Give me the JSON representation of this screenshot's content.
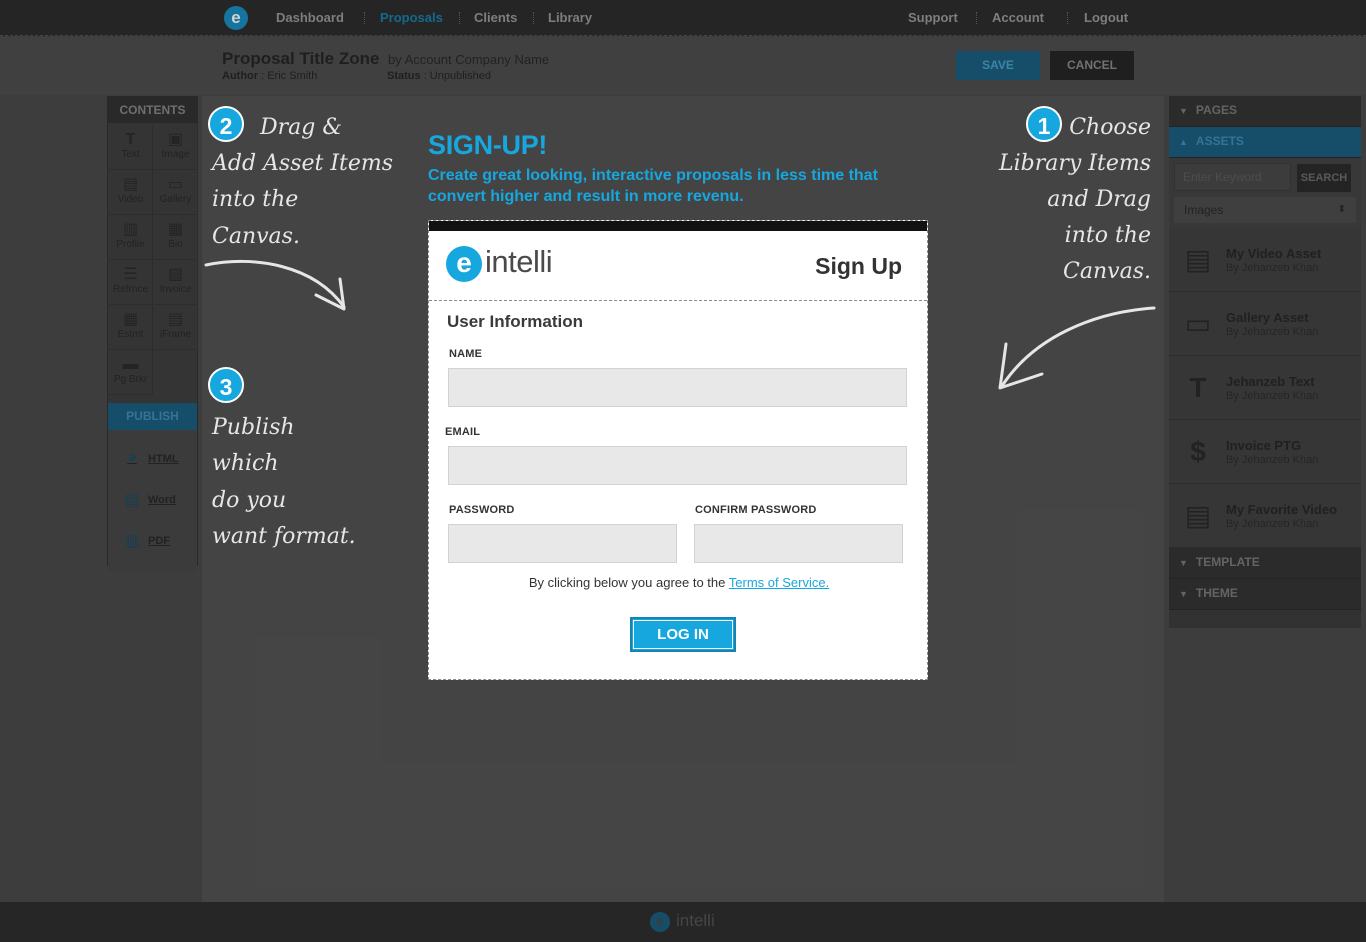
{
  "nav": {
    "items": [
      {
        "label": "Dashboard"
      },
      {
        "label": "Proposals"
      },
      {
        "label": "Clients"
      },
      {
        "label": "Library"
      }
    ],
    "right_items": [
      {
        "label": "Support"
      },
      {
        "label": "Account"
      },
      {
        "label": "Logout"
      }
    ],
    "logo_letter": "e"
  },
  "subheader": {
    "title": "Proposal Title Zone",
    "by": "by Account Company Name",
    "author_label": "Author",
    "author_value": ": Eric Smith",
    "status_label": "Status",
    "status_value": ": Unpublished",
    "save_label": "SAVE",
    "cancel_label": "CANCEL"
  },
  "contents": {
    "header": "CONTENTS",
    "tools": [
      {
        "label": "Text",
        "icon": "text-icon",
        "glyph": "T"
      },
      {
        "label": "Image",
        "icon": "image-icon",
        "glyph": "▣"
      },
      {
        "label": "Video",
        "icon": "video-icon",
        "glyph": "▤"
      },
      {
        "label": "Gallery",
        "icon": "gallery-icon",
        "glyph": "▭"
      },
      {
        "label": "Profile",
        "icon": "profile-icon",
        "glyph": "▥"
      },
      {
        "label": "Bio",
        "icon": "bio-icon",
        "glyph": "▦"
      },
      {
        "label": "Refrnce",
        "icon": "reference-icon",
        "glyph": "☰"
      },
      {
        "label": "Invoice",
        "icon": "invoice-icon",
        "glyph": "▧"
      },
      {
        "label": "Estmt",
        "icon": "estimate-icon",
        "glyph": "▦"
      },
      {
        "label": "iFrame",
        "icon": "iframe-icon",
        "glyph": "▤"
      },
      {
        "label": "Pg Brkr",
        "icon": "page-break-icon",
        "glyph": "▬"
      }
    ]
  },
  "publish": {
    "header": "PUBLISH",
    "items": [
      {
        "label": "HTML",
        "icon": "globe-icon"
      },
      {
        "label": "Word",
        "icon": "word-doc-icon"
      },
      {
        "label": "PDF",
        "icon": "pdf-doc-icon"
      }
    ]
  },
  "right_panel": {
    "pages_label": "PAGES",
    "assets_label": "ASSETS",
    "search_placeholder": "Enter Keyword",
    "search_button": "SEARCH",
    "filter_value": "Images",
    "assets": [
      {
        "title": "My Video Asset",
        "author": "By Jehanzeb Khan",
        "icon": "film-icon",
        "glyph": "▤"
      },
      {
        "title": "Gallery Asset",
        "author": "By Jehanzeb Khan",
        "icon": "gallery-frame-icon",
        "glyph": "▭"
      },
      {
        "title": "Jehanzeb Text",
        "author": "By Jehanzeb Khan",
        "icon": "text-icon",
        "glyph": "T"
      },
      {
        "title": "Invoice PTG",
        "author": "By Jehanzeb Khan",
        "icon": "invoice-icon",
        "glyph": "$"
      },
      {
        "title": "My Favorite Video",
        "author": "By Jehanzeb Khan",
        "icon": "film-icon",
        "glyph": "▤"
      }
    ],
    "template_label": "TEMPLATE",
    "theme_label": "THEME"
  },
  "tutorial": {
    "step1": {
      "number": "1",
      "lines": [
        "Choose",
        "Library Items",
        "and Drag",
        "into the",
        "Canvas."
      ]
    },
    "step2": {
      "number": "2",
      "lines": [
        "Drag &",
        "Add Asset Items",
        "into the",
        "Canvas."
      ]
    },
    "step3": {
      "number": "3",
      "lines": [
        "Publish",
        "which",
        "do you",
        "want format."
      ]
    }
  },
  "signup": {
    "heading": "SIGN-UP!",
    "subtext": "Create great looking, interactive proposals in less time that convert higher and result in more revenu.",
    "logo_letter": "e",
    "logo_text": "intelli",
    "title": "Sign Up",
    "section_title": "User Information",
    "name_label": "NAME",
    "email_label": "EMAIL",
    "password_label": "PASSWORD",
    "confirm_password_label": "CONFIRM PASSWORD",
    "terms_prefix": "By clicking below you agree to the",
    "terms_link": "Terms of Service.",
    "login_button": "LOG IN"
  },
  "footer": {
    "logo_letter": "e",
    "brand": "intelli"
  },
  "colors": {
    "accent": "#17a7df",
    "dark_accent": "#1c5f80",
    "nav_bg": "#2e2e2e"
  }
}
